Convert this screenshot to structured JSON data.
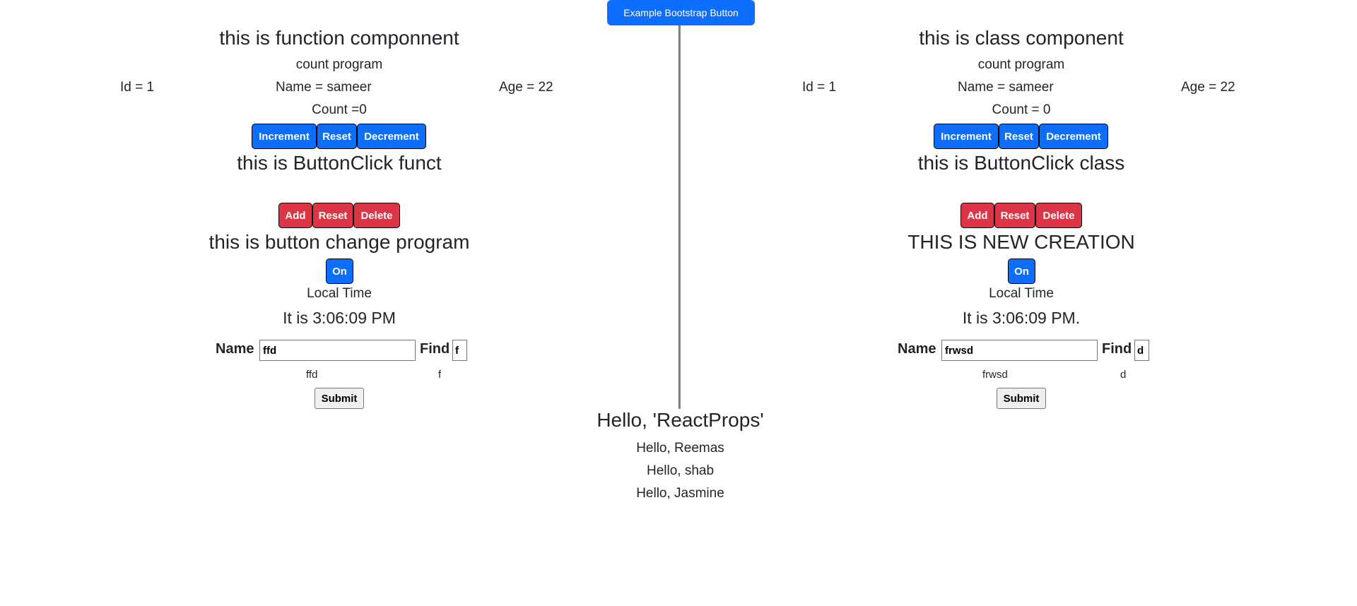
{
  "header": {
    "bootstrap_button": "Example Bootstrap Button"
  },
  "left": {
    "title": "this is function componnent",
    "subtitle": "count program",
    "id_text": "Id = 1",
    "name_text": "Name = sameer",
    "age_text": "Age = 22",
    "count_text": "Count =0",
    "count_buttons": {
      "increment": "Increment",
      "reset": "Reset",
      "decrement": "Decrement"
    },
    "click_title": "this is ButtonClick funct",
    "click_buttons": {
      "add": "Add",
      "reset": "Reset",
      "delete": "Delete"
    },
    "change_title": "this is button change program",
    "toggle_label": "On",
    "local_time_label": "Local Time",
    "time_text": "It is 3:06:09 PM",
    "form": {
      "name_label": "Name",
      "name_value": "ffd",
      "find_label": "Find",
      "find_value": "f",
      "name_echo": "ffd",
      "find_echo": "f",
      "submit_label": "Submit"
    }
  },
  "right": {
    "title": "this is class component",
    "subtitle": "count program",
    "id_text": "Id = 1",
    "name_text": "Name = sameer",
    "age_text": "Age = 22",
    "count_text": "Count = 0",
    "count_buttons": {
      "increment": "Increment",
      "reset": "Reset",
      "decrement": "Decrement"
    },
    "click_title": "this is ButtonClick class",
    "click_buttons": {
      "add": "Add",
      "reset": "Reset",
      "delete": "Delete"
    },
    "change_title": "THIS IS NEW CREATION",
    "toggle_label": "On",
    "local_time_label": "Local Time",
    "time_text": "It is 3:06:09 PM.",
    "form": {
      "name_label": "Name",
      "name_value": "frwsd",
      "find_label": "Find",
      "find_value": "d",
      "name_echo": "frwsd",
      "find_echo": "d",
      "submit_label": "Submit"
    }
  },
  "props": {
    "heading": "Hello, 'ReactProps'",
    "greetings": [
      "Hello, Reemas",
      "Hello, shab",
      "Hello, Jasmine"
    ]
  },
  "colors": {
    "primary": "#0d6efd",
    "danger": "#dc3545",
    "text": "#212529"
  }
}
